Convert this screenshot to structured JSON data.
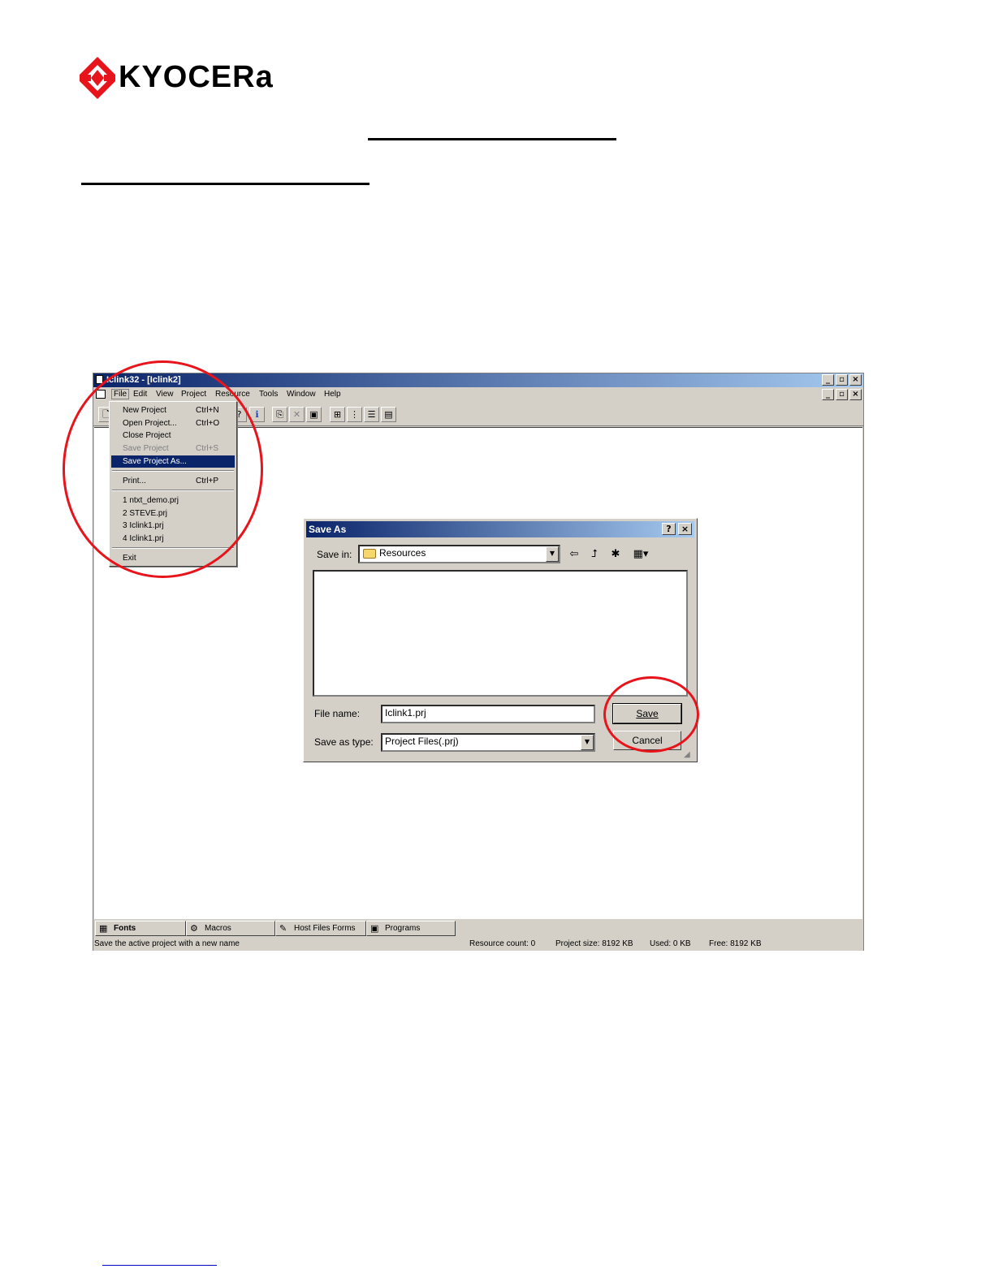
{
  "brand": {
    "logo_text": "KYOCERa",
    "logo_color": "#e8141b"
  },
  "app": {
    "title": "Iclink32 - [Iclink2]",
    "menubar": [
      "File",
      "Edit",
      "View",
      "Project",
      "Resource",
      "Tools",
      "Window",
      "Help"
    ],
    "file_menu": {
      "items": [
        {
          "label": "New Project",
          "shortcut": "Ctrl+N"
        },
        {
          "label": "Open Project...",
          "shortcut": "Ctrl+O"
        },
        {
          "label": "Close Project",
          "shortcut": ""
        },
        {
          "label": "Save Project",
          "shortcut": "Ctrl+S"
        },
        {
          "label": "Save Project As...",
          "shortcut": ""
        },
        {
          "label": "Print...",
          "shortcut": "Ctrl+P"
        },
        {
          "label": "1 ntxt_demo.prj",
          "shortcut": ""
        },
        {
          "label": "2 STEVE.prj",
          "shortcut": ""
        },
        {
          "label": "3 Iclink1.prj",
          "shortcut": ""
        },
        {
          "label": "4 Iclink1.prj",
          "shortcut": ""
        },
        {
          "label": "Exit",
          "shortcut": ""
        }
      ]
    },
    "tabs": [
      "Fonts",
      "Macros",
      "Host Files Forms",
      "Programs"
    ],
    "status": {
      "message": "Save the active project with a new name",
      "resource_count": "Resource count:  0",
      "project_size": "Project size: 8192 KB",
      "used": "Used: 0 KB",
      "free": "Free: 8192 KB"
    }
  },
  "dialog": {
    "title": "Save As",
    "help_glyph": "?",
    "close_glyph": "×",
    "save_in_label": "Save in:",
    "save_in_value": "Resources",
    "file_name_label": "File name:",
    "file_name_value": "Iclink1.prj",
    "save_as_type_label": "Save as type:",
    "save_as_type_value": "Project Files(.prj)",
    "save_button": "Save",
    "cancel_button": "Cancel"
  },
  "colors": {
    "title_bar": "#0a246a",
    "selection": "#0a246a",
    "annotation": "#e8141b",
    "chrome": "#d4d0c8"
  }
}
